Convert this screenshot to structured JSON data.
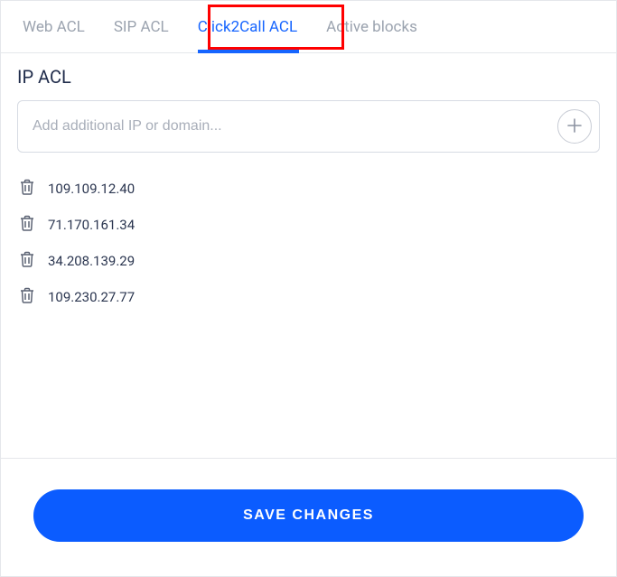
{
  "tabs": [
    {
      "label": "Web ACL",
      "active": false
    },
    {
      "label": "SIP ACL",
      "active": false
    },
    {
      "label": "Click2Call ACL",
      "active": true
    },
    {
      "label": "Active blocks",
      "active": false
    }
  ],
  "section_title": "IP ACL",
  "input": {
    "placeholder": "Add additional IP or domain...",
    "value": ""
  },
  "entries": [
    {
      "ip": "109.109.12.40"
    },
    {
      "ip": "71.170.161.34"
    },
    {
      "ip": "34.208.139.29"
    },
    {
      "ip": "109.230.27.77"
    }
  ],
  "save_label": "SAVE CHANGES"
}
